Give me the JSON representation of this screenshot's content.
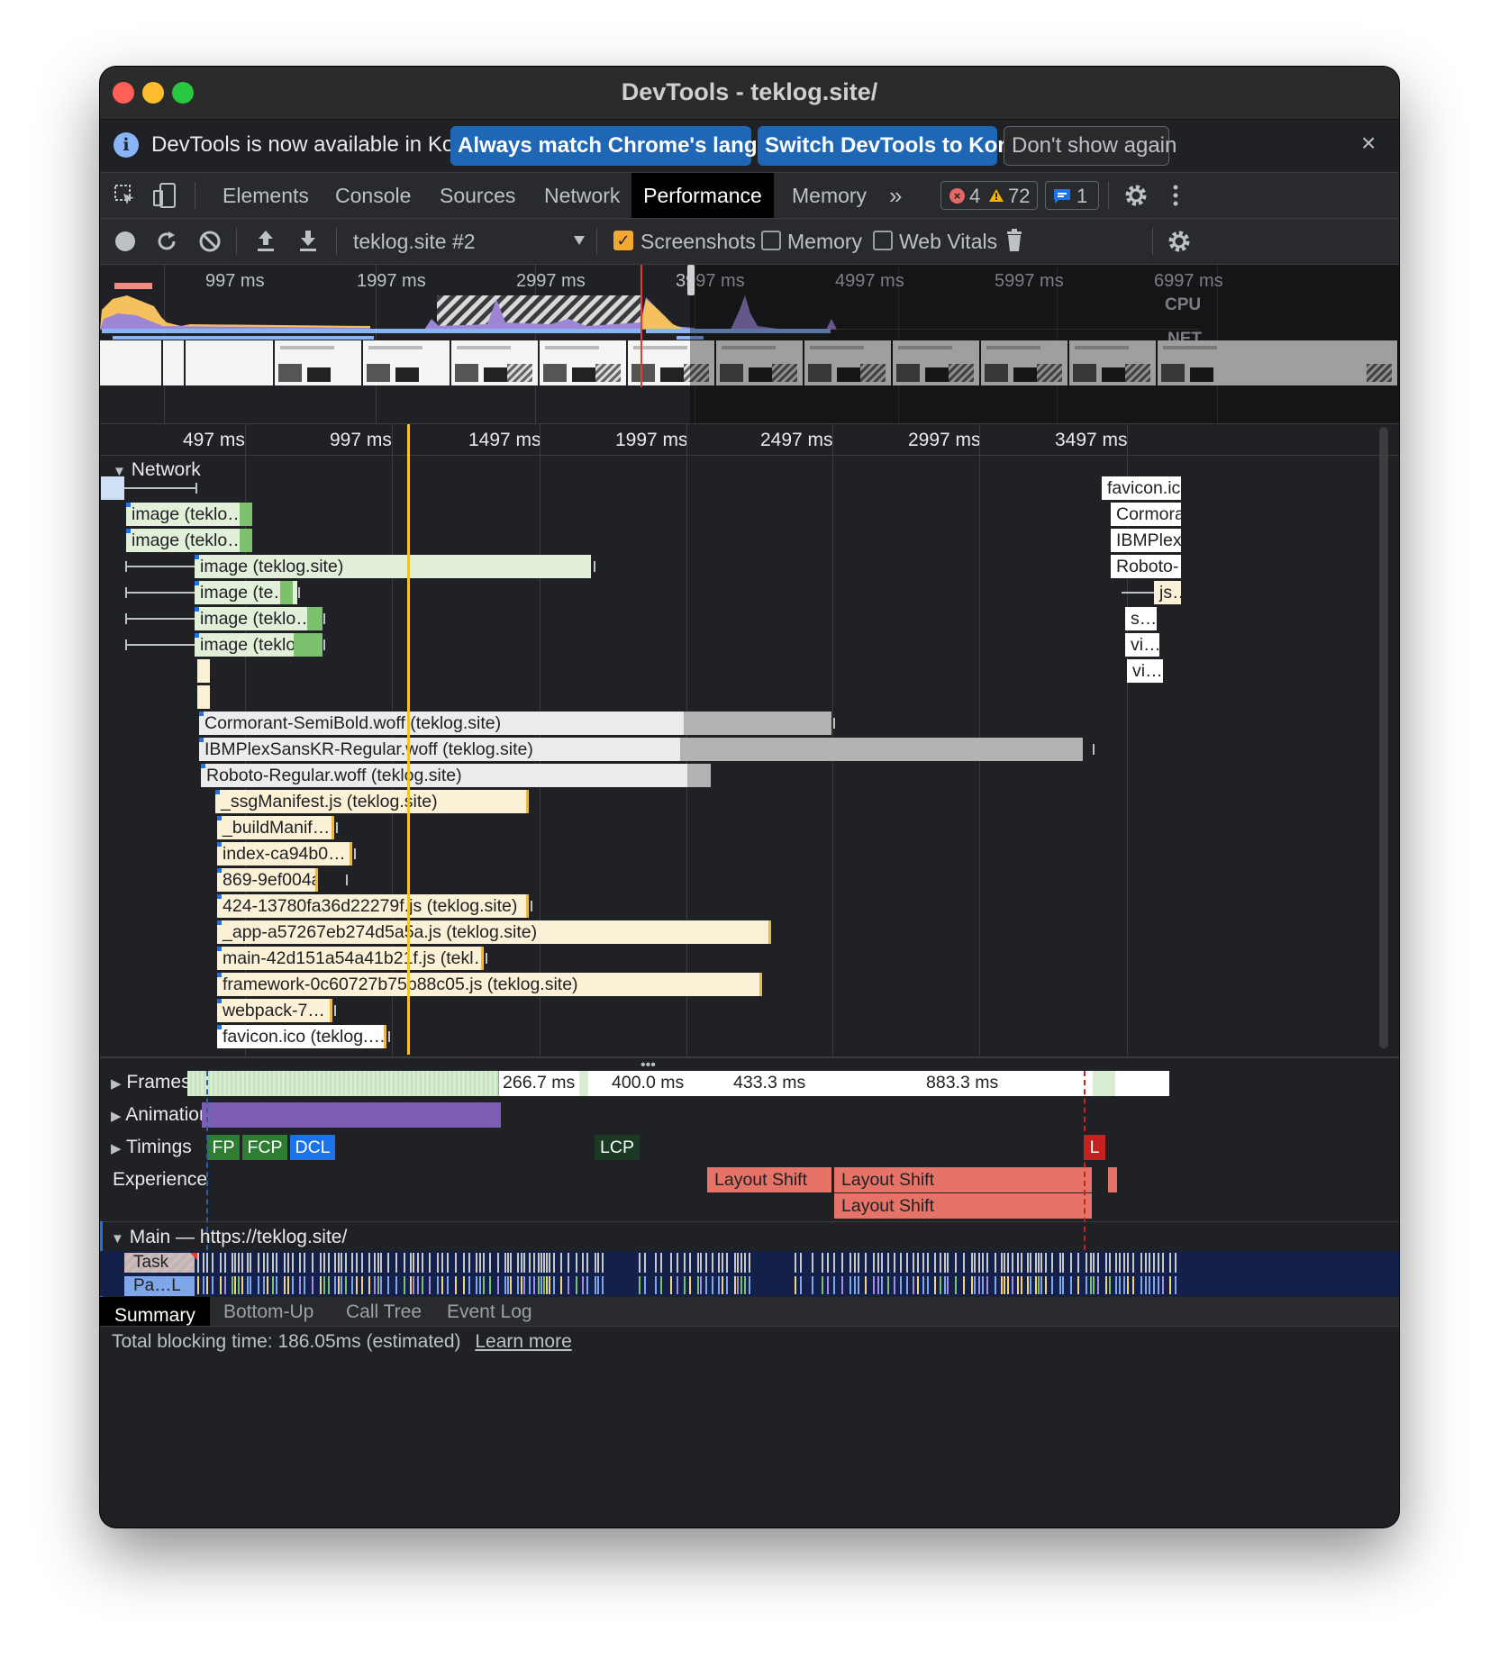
{
  "window": {
    "title": "DevTools - teklog.site/"
  },
  "infobar": {
    "message": "DevTools is now available in Korean!",
    "match_label": "Always match Chrome's language",
    "switch_label": "Switch DevTools to Korean",
    "dismiss_label": "Don't show again",
    "close": "×"
  },
  "tabs": [
    "Elements",
    "Console",
    "Sources",
    "Network",
    "Performance",
    "Memory"
  ],
  "active_tab": "Performance",
  "more_tabs": "»",
  "counts": {
    "errors": "4",
    "warnings": "72",
    "messages": "1"
  },
  "toolbar": {
    "profile": "teklog.site #2",
    "screenshots": "Screenshots",
    "memory": "Memory",
    "web_vitals": "Web Vitals",
    "screenshots_checked": true,
    "memory_checked": false,
    "web_vitals_checked": false
  },
  "overview": {
    "ticks": [
      "997 ms",
      "1997 ms",
      "2997 ms",
      "3997 ms",
      "4997 ms",
      "5997 ms",
      "6997 ms"
    ],
    "cpu_label": "CPU",
    "net_label": "NET"
  },
  "ruler": [
    "497 ms",
    "997 ms",
    "1497 ms",
    "1997 ms",
    "2497 ms",
    "2997 ms",
    "3497 ms"
  ],
  "network": {
    "title": "Network",
    "requests": [
      "image (teklo…",
      "image (teklo…",
      "image (teklog.site)",
      "image (te…",
      "image (teklo…",
      "image (teklog…",
      "Cormorant-SemiBold.woff (teklog.site)",
      "IBMPlexSansKR-Regular.woff (teklog.site)",
      "Roboto-Regular.woff (teklog.site)",
      "_ssgManifest.js (teklog.site)",
      "_buildManif…",
      "index-ca94b0…",
      "869-9ef004a…",
      "424-13780fa36d22279f.js (teklog.site)",
      "_app-a57267eb274d5a5a.js (teklog.site)",
      "main-42d151a54a41b21f.js (tekl…",
      "framework-0c60727b75b88c05.js (teklog.site)",
      "webpack-7…",
      "favicon.ico (teklog.…"
    ],
    "right_requests": [
      "favicon.ico",
      "Cormora",
      "IBMPlex",
      "Roboto-",
      "js…",
      "s…",
      "vi…",
      "vi…"
    ]
  },
  "tracks": {
    "frames": "Frames",
    "frame_times": [
      "266.7 ms",
      "400.0 ms",
      "433.3 ms",
      "883.3 ms"
    ],
    "animation": "Animation",
    "timings": "Timings",
    "timing_marks": [
      "FP",
      "FCP",
      "DCL",
      "LCP",
      "L"
    ],
    "experience": "Experience",
    "layout_shift": "Layout Shift",
    "main": "Main — https://teklog.site/",
    "task": "Task",
    "task2": "Pa…L"
  },
  "bottom_tabs": [
    "Summary",
    "Bottom-Up",
    "Call Tree",
    "Event Log"
  ],
  "status": {
    "text": "Total blocking time: 186.05ms (estimated)",
    "link": "Learn more"
  },
  "colors": {
    "accent": "#1a73e8",
    "marker": "#f4c430",
    "image": "#e2efd9",
    "font": "#ececec",
    "script": "#fbf1d6",
    "layout_shift": "#e57367"
  }
}
